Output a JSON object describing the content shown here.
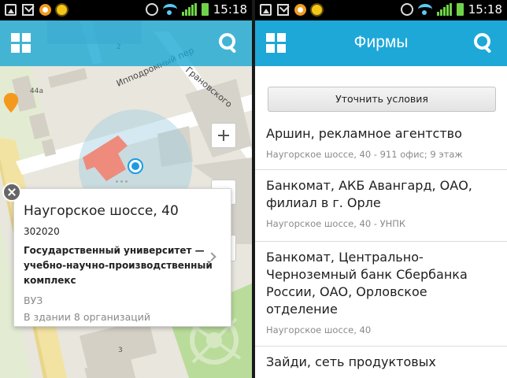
{
  "status_bar": {
    "time": "15:18"
  },
  "map_screen": {
    "house_number_label": "44a",
    "street_labels": {
      "street1": "Ипподромный пер",
      "street2": "Грановского"
    },
    "building_numbers": {
      "b2": "2",
      "b3": "3"
    },
    "popup": {
      "address": "Наугорское шоссе, 40",
      "postal_code": "302020",
      "organization": "Государственный университет — учебно-научно-производственный комплекс",
      "type": "ВУЗ",
      "org_count": "В здании 8 организаций"
    }
  },
  "firms_screen": {
    "title": "Фирмы",
    "refine_button": "Уточнить условия",
    "firms": [
      {
        "name": "Аршин, рекламное агентство",
        "address": "Наугорское шоссе, 40 - 911 офис; 9 этаж"
      },
      {
        "name": "Банкомат, АКБ Авангард, ОАО, филиал в г. Орле",
        "address": "Наугорское шоссе, 40 - УНПК"
      },
      {
        "name": "Банкомат, Центрально-Черноземный банк Сбербанка России, ОАО, Орловское отделение",
        "address": "Наугорское шоссе, 40"
      },
      {
        "name": "Зайди, сеть продуктовых",
        "address": ""
      }
    ]
  },
  "colors": {
    "app_bar": "#1da8d8",
    "location_dot": "#1e9be0",
    "marker": "#f39a1e"
  }
}
